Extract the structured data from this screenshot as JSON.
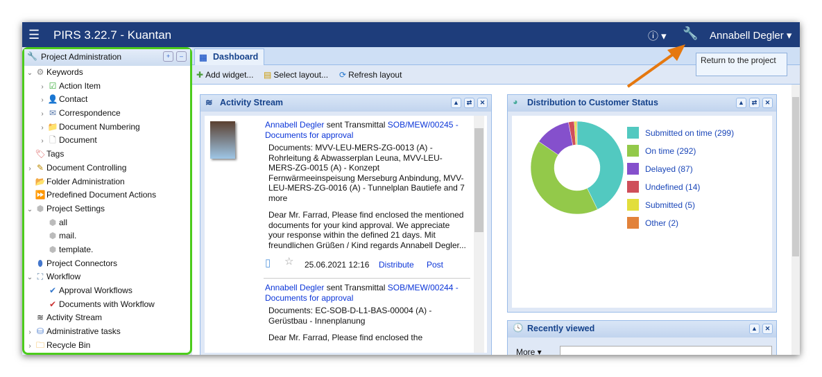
{
  "header": {
    "menu_icon": "hamburger-icon",
    "title": "PIRS 3.22.7  -  Kuantan",
    "help_icon": "help-icon",
    "admin_icon": "wrench-icon",
    "user": "Annabell Degler"
  },
  "tooltip": "Return to the project",
  "left_panel": {
    "title": "Project Administration",
    "tree": [
      {
        "label": "Keywords",
        "level": 0,
        "expander": "open",
        "icon": "gear-icon"
      },
      {
        "label": "Action Item",
        "level": 1,
        "expander": "closed",
        "icon": "checkmark-icon"
      },
      {
        "label": "Contact",
        "level": 1,
        "expander": "closed",
        "icon": "person-icon"
      },
      {
        "label": "Correspondence",
        "level": 1,
        "expander": "closed",
        "icon": "envelope-icon"
      },
      {
        "label": "Document Numbering",
        "level": 1,
        "expander": "closed",
        "icon": "folder-icon"
      },
      {
        "label": "Document",
        "level": 1,
        "expander": "closed",
        "icon": "document-icon"
      },
      {
        "label": "Tags",
        "level": 0,
        "expander": "",
        "icon": "tag-icon"
      },
      {
        "label": "Document Controlling",
        "level": 0,
        "expander": "closed",
        "icon": "pencil-icon"
      },
      {
        "label": "Folder Administration",
        "level": 0,
        "expander": "",
        "icon": "folder-edit-icon"
      },
      {
        "label": "Predefined Document Actions",
        "level": 0,
        "expander": "",
        "icon": "forward-icon"
      },
      {
        "label": "Project Settings",
        "level": 0,
        "expander": "open",
        "icon": "cube-icon"
      },
      {
        "label": "all",
        "level": 1,
        "expander": "",
        "icon": "cube-icon"
      },
      {
        "label": "mail.",
        "level": 1,
        "expander": "",
        "icon": "cube-icon"
      },
      {
        "label": "template.",
        "level": 1,
        "expander": "",
        "icon": "cube-icon"
      },
      {
        "label": "Project Connectors",
        "level": 0,
        "expander": "",
        "icon": "connector-icon"
      },
      {
        "label": "Workflow",
        "level": 0,
        "expander": "open",
        "icon": "workflow-icon"
      },
      {
        "label": "Approval Workflows",
        "level": 1,
        "expander": "",
        "icon": "approval-icon"
      },
      {
        "label": "Documents with Workflow",
        "level": 1,
        "expander": "",
        "icon": "document-check-icon"
      },
      {
        "label": "Activity Stream",
        "level": 0,
        "expander": "",
        "icon": "stream-icon"
      },
      {
        "label": "Administrative tasks",
        "level": 0,
        "expander": "closed",
        "icon": "tasks-icon"
      },
      {
        "label": "Recycle Bin",
        "level": 0,
        "expander": "closed",
        "icon": "recycle-bin-icon"
      }
    ]
  },
  "tabs": [
    {
      "label": "Dashboard",
      "active": true
    }
  ],
  "toolbar": {
    "add_widget": "Add widget...",
    "select_layout": "Select layout...",
    "refresh_layout": "Refresh layout"
  },
  "activity": {
    "title": "Activity Stream",
    "items": [
      {
        "user": "Annabell Degler",
        "verb": " sent Transmittal ",
        "link": "SOB/MEW/00245 - Documents for approval",
        "docs": "Documents: MVV-LEU-MERS-ZG-0013 (A) - Rohrleitung & Abwasserplan Leuna, MVV-LEU-MERS-ZG-0015 (A) - Konzept Fernwärmeeinspeisung Merseburg Anbindung, MVV-LEU-MERS-ZG-0016 (A) - Tunnelplan Bautiefe and 7 more",
        "message": "Dear Mr. Farrad, Please find enclosed the mentioned documents for your kind approval. We appreciate your response within the defined 21 days. Mit freundlichen Grüßen / Kind regards Annabell Degler...",
        "date": "25.06.2021 12:16",
        "distribute": "Distribute",
        "post": "Post"
      },
      {
        "user": "Annabell Degler",
        "verb": " sent Transmittal ",
        "link": "SOB/MEW/00244 - Documents for approval",
        "docs": "Documents: EC-SOB-D-L1-BAS-00004 (A) - Gerüstbau - Innenplanung",
        "message": "Dear Mr. Farrad, Please find enclosed the"
      }
    ]
  },
  "distribution": {
    "title": "Distribution to Customer Status"
  },
  "chart_data": {
    "type": "pie",
    "donut": true,
    "title": "Distribution to Customer Status",
    "legend": "right",
    "categories": [
      "Submitted on time",
      "On time",
      "Delayed",
      "Undefined",
      "Submitted",
      "Other"
    ],
    "values": [
      299,
      292,
      87,
      14,
      5,
      2
    ],
    "labels": [
      "Submitted on time (299)",
      "On time (292)",
      "Delayed (87)",
      "Undefined (14)",
      "Submitted (5)",
      "Other (2)"
    ],
    "colors": [
      "#52c9c0",
      "#93c94a",
      "#8550cc",
      "#cf4f5a",
      "#e2de3c",
      "#e2823a"
    ]
  },
  "recent": {
    "title": "Recently viewed",
    "more": "More"
  }
}
